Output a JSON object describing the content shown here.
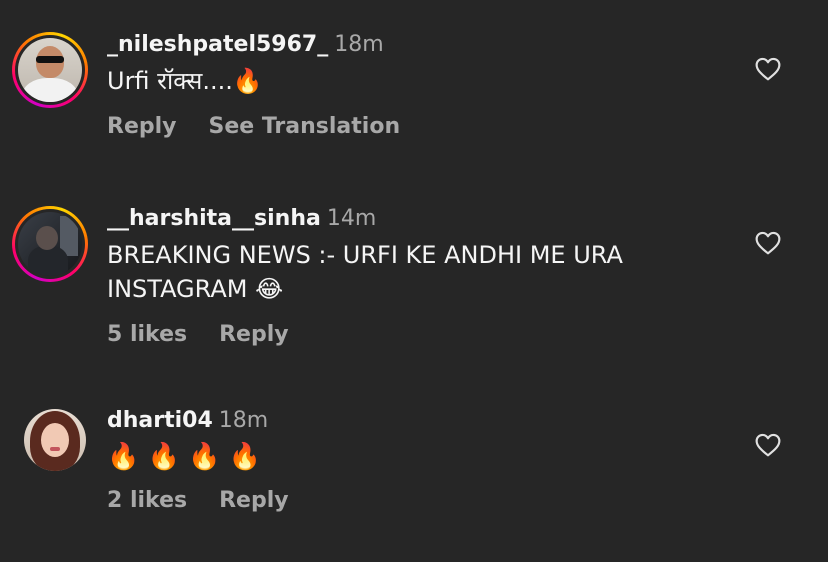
{
  "comments": [
    {
      "username": "_nileshpatel5967_",
      "time": "18m",
      "text": "Urfi रॉक्स....🔥",
      "actions": [
        "Reply",
        "See Translation"
      ]
    },
    {
      "username": "__harshita__sinha",
      "time": "14m",
      "text_line1": "BREAKING NEWS :- URFI KE ANDHI ME URA",
      "text_line2": "INSTAGRAM 😂",
      "likes": "5 likes",
      "reply": "Reply"
    },
    {
      "username": "dharti04",
      "time": "18m",
      "text": "🔥 🔥 🔥 🔥",
      "likes": "2 likes",
      "reply": "Reply"
    }
  ],
  "icons": {
    "heart": "heart-outline-icon",
    "story_ring_colors": [
      "#d300c5",
      "#ff0069",
      "#ff7a00",
      "#ffd600"
    ]
  },
  "colors": {
    "background": "#262626",
    "primary_text": "#f5f5f5",
    "secondary_text": "#a8a8a8"
  }
}
